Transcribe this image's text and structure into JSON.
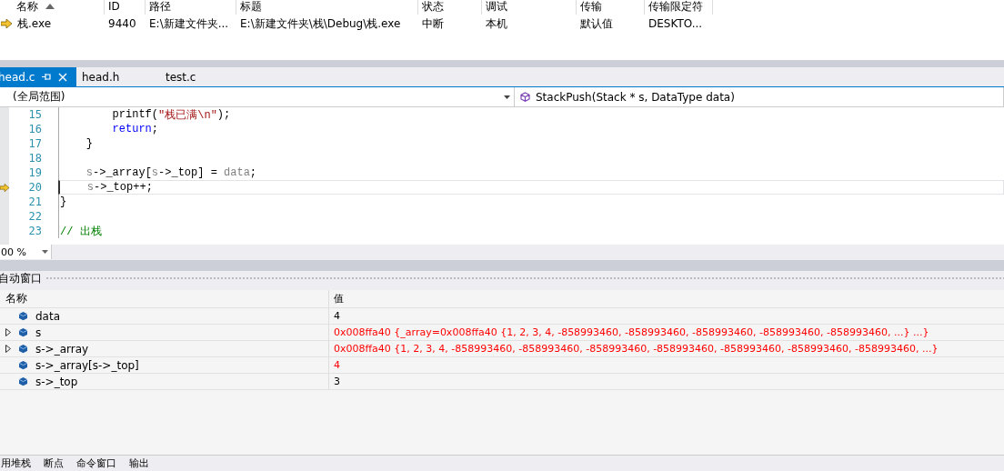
{
  "processes": {
    "columns": [
      {
        "label": "名称",
        "sorted": true
      },
      {
        "label": "ID",
        "sorted": false
      },
      {
        "label": "路径",
        "sorted": false
      },
      {
        "label": "标题",
        "sorted": false
      },
      {
        "label": "状态",
        "sorted": false
      },
      {
        "label": "调试",
        "sorted": false
      },
      {
        "label": "传输",
        "sorted": false
      },
      {
        "label": "传输限定符",
        "sorted": false
      }
    ],
    "rows": [
      {
        "current": true,
        "cells": [
          "栈.exe",
          "9440",
          "E:\\新建文件夹...",
          "E:\\新建文件夹\\栈\\Debug\\栈.exe",
          "中断",
          "本机",
          "默认值",
          "DESKTO..."
        ]
      }
    ]
  },
  "editor_tabs": [
    {
      "label": "head.c",
      "selected": true
    },
    {
      "label": "head.h",
      "selected": false
    },
    {
      "label": "test.c",
      "selected": false
    }
  ],
  "scope": "(全局范围)",
  "function": "StackPush(Stack * s, DataType data)",
  "code": [
    {
      "number": "15",
      "current": false,
      "tokens": [
        {
          "kind": "plain",
          "t": "        printf("
        },
        {
          "kind": "string",
          "t": "\"栈已满\\n\""
        },
        {
          "kind": "plain",
          "t": ");"
        }
      ]
    },
    {
      "number": "16",
      "current": false,
      "tokens": [
        {
          "kind": "keyword",
          "t": "        return"
        },
        {
          "kind": "plain",
          "t": ";"
        }
      ]
    },
    {
      "number": "17",
      "current": false,
      "tokens": [
        {
          "kind": "plain",
          "t": "    }"
        }
      ]
    },
    {
      "number": "18",
      "current": false
    },
    {
      "number": "19",
      "current": false,
      "tokens": [
        {
          "kind": "param",
          "t": "    s"
        },
        {
          "kind": "plain",
          "t": "->_array["
        },
        {
          "kind": "param",
          "t": "s"
        },
        {
          "kind": "plain",
          "t": "->_top] = "
        },
        {
          "kind": "param",
          "t": "data"
        },
        {
          "kind": "plain",
          "t": ";"
        }
      ]
    },
    {
      "number": "20",
      "current": true,
      "tokens": [
        {
          "kind": "param",
          "t": "    s"
        },
        {
          "kind": "plain",
          "t": "->_top++;"
        }
      ]
    },
    {
      "number": "21",
      "current": false,
      "tokens": [
        {
          "kind": "plain",
          "t": "}"
        }
      ]
    },
    {
      "number": "22",
      "current": false
    },
    {
      "number": "23",
      "current": false,
      "tokens": [
        {
          "kind": "comment",
          "t": "// 出栈"
        }
      ]
    }
  ],
  "zoom": "00 %",
  "autos": {
    "title": "自动窗口",
    "columns": [
      "名称",
      "值"
    ],
    "rows": [
      {
        "name": "data",
        "value": "4",
        "expandable": false,
        "changed": false
      },
      {
        "name": "s",
        "value": "0x008ffa40 {_array=0x008ffa40 {1, 2, 3, 4, -858993460, -858993460, -858993460, -858993460, -858993460, ...} ...}",
        "expandable": true,
        "changed": true
      },
      {
        "name": "s->_array",
        "value": "0x008ffa40 {1, 2, 3, 4, -858993460, -858993460, -858993460, -858993460, -858993460, -858993460, -858993460, ...}",
        "expandable": true,
        "changed": true
      },
      {
        "name": "s->_array[s->_top]",
        "value": "4",
        "expandable": false,
        "changed": true
      },
      {
        "name": "s->_top",
        "value": "3",
        "expandable": false,
        "changed": false
      }
    ]
  },
  "bottom_tabs": [
    "用堆栈",
    "断点",
    "命令窗口",
    "输出"
  ]
}
